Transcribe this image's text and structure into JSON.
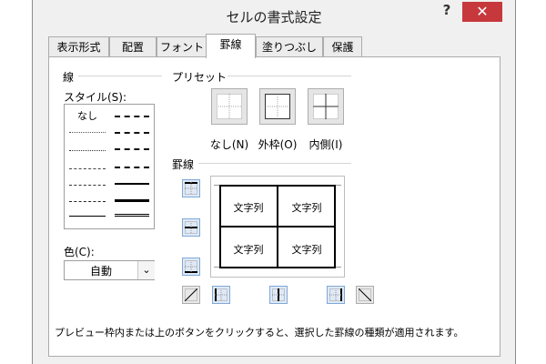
{
  "window": {
    "title": "セルの書式設定",
    "help": "?",
    "close": "✕"
  },
  "tabs": [
    "表示形式",
    "配置",
    "フォント",
    "罫線",
    "塗りつぶし",
    "保護"
  ],
  "active_tab": "罫線",
  "line_section": {
    "heading": "線",
    "style_label": "スタイル(S):",
    "style_none": "なし",
    "color_label": "色(C):",
    "color_value": "自動"
  },
  "preset_section": {
    "heading": "プリセット",
    "buttons": [
      "なし(N)",
      "外枠(O)",
      "内側(I)"
    ]
  },
  "border_section": {
    "heading": "罫線",
    "cell_text": "文字列"
  },
  "hint": "プレビュー枠内または上のボタンをクリックすると、選択した罫線の種類が適用されます。",
  "colors": {
    "close_bg": "#c7383d",
    "button_selected_border": "#7fa8d8",
    "button_selected_bg": "#dfe9f6"
  }
}
